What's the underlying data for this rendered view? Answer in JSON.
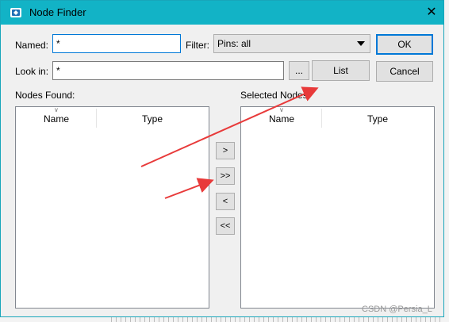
{
  "window": {
    "title": "Node Finder",
    "close_glyph": "✕"
  },
  "form": {
    "named_label": "Named:",
    "named_value": "*",
    "filter_label": "Filter:",
    "filter_value": "Pins: all",
    "lookin_label": "Look in:",
    "lookin_value": "*",
    "browse_label": "..."
  },
  "buttons": {
    "ok": "OK",
    "list": "List",
    "cancel": "Cancel"
  },
  "nodes_found": {
    "label": "Nodes Found:",
    "columns": [
      "Name",
      "Type"
    ],
    "sort_indicator": "∨"
  },
  "selected_nodes": {
    "label": "Selected Nodes:",
    "columns": [
      "Name",
      "Type"
    ],
    "sort_indicator": "∨"
  },
  "transfer": {
    "add_one": ">",
    "add_all": ">>",
    "remove_one": "<",
    "remove_all": "<<"
  },
  "watermark": "CSDN @Persia_L",
  "annotation_color": "#e83a3a"
}
